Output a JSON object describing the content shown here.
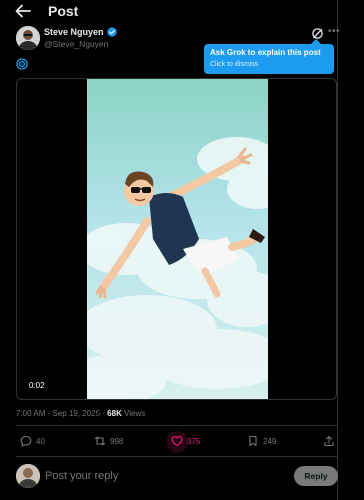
{
  "header": {
    "title": "Post",
    "back_icon": "arrow-left-icon"
  },
  "author": {
    "name": "Steve Nguyen",
    "handle": "@Steve_Nguyen",
    "verified_icon": "verified-badge-icon",
    "verified_color": "#1d9bf0"
  },
  "tooltip": {
    "title": "Ask Grok to explain this post",
    "subtitle": "Click to dismiss",
    "color": "#1d9bf0"
  },
  "media": {
    "type": "video",
    "timecode": "0:02",
    "description_icon": "cartoon-skydiver"
  },
  "meta": {
    "timestamp": "7:00 AM · Sep 19, 2025 · ",
    "views_count": "68K",
    "views_label": " Views"
  },
  "actions": {
    "replies": "40",
    "reposts": "998",
    "likes": "375",
    "bookmarks": "249",
    "like_color": "#f91880",
    "liked": true
  },
  "reply": {
    "placeholder": "Post your reply",
    "button_label": "Reply"
  }
}
